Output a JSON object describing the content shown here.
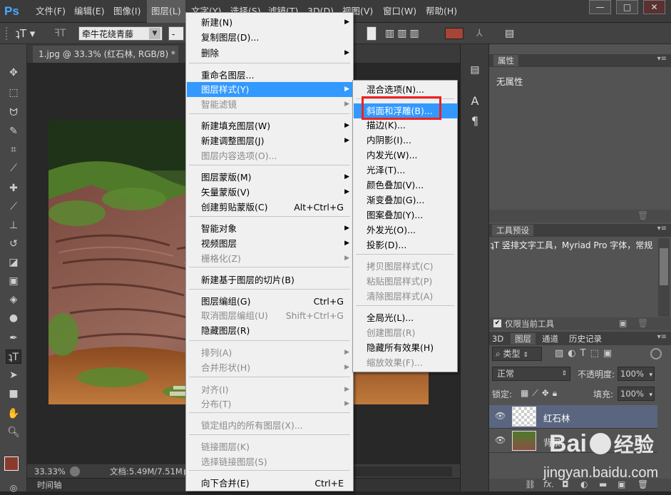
{
  "app": {
    "logo": "Ps"
  },
  "menubar": {
    "items": [
      "文件(F)",
      "编辑(E)",
      "图像(I)",
      "图层(L)",
      "文字(Y)",
      "选择(S)",
      "滤镜(T)",
      "3D(D)",
      "视图(V)",
      "窗口(W)",
      "帮助(H)"
    ],
    "window_controls": [
      "minimize",
      "maximize",
      "close"
    ]
  },
  "options_bar": {
    "tool_icon": "text-vertical-icon",
    "font_name": "牵牛花绕青藤",
    "font_style": "-",
    "color_swatch": "#a84436"
  },
  "document": {
    "tab_title": "1.jpg @ 33.3% (红石林, RGB/8) *",
    "close_label": "×"
  },
  "status": {
    "zoom": "33.33%",
    "doc_info": "文档:5.49M/7.51M"
  },
  "timeline": {
    "label": "时间轴"
  },
  "layer_menu": {
    "items": [
      {
        "label": "新建(N)",
        "shortcut": "",
        "arrow": true,
        "disabled": false
      },
      {
        "label": "复制图层(D)...",
        "shortcut": "",
        "arrow": false,
        "disabled": false
      },
      {
        "label": "删除",
        "shortcut": "",
        "arrow": true,
        "disabled": false
      },
      {
        "label": "重命名图层...",
        "shortcut": "",
        "arrow": false,
        "disabled": false
      },
      {
        "label": "图层样式(Y)",
        "shortcut": "",
        "arrow": true,
        "disabled": false
      },
      {
        "label": "智能滤镜",
        "shortcut": "",
        "arrow": true,
        "disabled": true
      },
      {
        "label": "新建填充图层(W)",
        "shortcut": "",
        "arrow": true,
        "disabled": false
      },
      {
        "label": "新建调整图层(J)",
        "shortcut": "",
        "arrow": true,
        "disabled": false
      },
      {
        "label": "图层内容选项(O)...",
        "shortcut": "",
        "arrow": false,
        "disabled": true
      },
      {
        "label": "图层蒙版(M)",
        "shortcut": "",
        "arrow": true,
        "disabled": false
      },
      {
        "label": "矢量蒙版(V)",
        "shortcut": "",
        "arrow": true,
        "disabled": false
      },
      {
        "label": "创建剪贴蒙版(C)",
        "shortcut": "Alt+Ctrl+G",
        "arrow": false,
        "disabled": false
      },
      {
        "label": "智能对象",
        "shortcut": "",
        "arrow": true,
        "disabled": false
      },
      {
        "label": "视频图层",
        "shortcut": "",
        "arrow": true,
        "disabled": false
      },
      {
        "label": "栅格化(Z)",
        "shortcut": "",
        "arrow": true,
        "disabled": true
      },
      {
        "label": "新建基于图层的切片(B)",
        "shortcut": "",
        "arrow": false,
        "disabled": false
      },
      {
        "label": "图层编组(G)",
        "shortcut": "Ctrl+G",
        "arrow": false,
        "disabled": false
      },
      {
        "label": "取消图层编组(U)",
        "shortcut": "Shift+Ctrl+G",
        "arrow": false,
        "disabled": true
      },
      {
        "label": "隐藏图层(R)",
        "shortcut": "",
        "arrow": false,
        "disabled": false
      },
      {
        "label": "排列(A)",
        "shortcut": "",
        "arrow": true,
        "disabled": true
      },
      {
        "label": "合并形状(H)",
        "shortcut": "",
        "arrow": true,
        "disabled": true
      },
      {
        "label": "对齐(I)",
        "shortcut": "",
        "arrow": true,
        "disabled": true
      },
      {
        "label": "分布(T)",
        "shortcut": "",
        "arrow": true,
        "disabled": true
      },
      {
        "label": "锁定组内的所有图层(X)...",
        "shortcut": "",
        "arrow": false,
        "disabled": true
      },
      {
        "label": "链接图层(K)",
        "shortcut": "",
        "arrow": false,
        "disabled": true
      },
      {
        "label": "选择链接图层(S)",
        "shortcut": "",
        "arrow": false,
        "disabled": true
      },
      {
        "label": "向下合并(E)",
        "shortcut": "Ctrl+E",
        "arrow": false,
        "disabled": false
      }
    ]
  },
  "style_submenu": {
    "items": [
      {
        "label": "混合选项(N)...",
        "disabled": false
      },
      {
        "label": "斜面和浮雕(B)...",
        "disabled": false
      },
      {
        "label": "描边(K)...",
        "disabled": false
      },
      {
        "label": "内阴影(I)...",
        "disabled": false
      },
      {
        "label": "内发光(W)...",
        "disabled": false
      },
      {
        "label": "光泽(T)...",
        "disabled": false
      },
      {
        "label": "颜色叠加(V)...",
        "disabled": false
      },
      {
        "label": "渐变叠加(G)...",
        "disabled": false
      },
      {
        "label": "图案叠加(Y)...",
        "disabled": false
      },
      {
        "label": "外发光(O)...",
        "disabled": false
      },
      {
        "label": "投影(D)...",
        "disabled": false
      },
      {
        "label": "拷贝图层样式(C)",
        "disabled": true
      },
      {
        "label": "粘贴图层样式(P)",
        "disabled": true
      },
      {
        "label": "清除图层样式(A)",
        "disabled": true
      },
      {
        "label": "全局光(L)...",
        "disabled": false
      },
      {
        "label": "创建图层(R)",
        "disabled": true
      },
      {
        "label": "隐藏所有效果(H)",
        "disabled": false
      },
      {
        "label": "缩放效果(F)...",
        "disabled": true
      }
    ]
  },
  "properties_panel": {
    "tab": "属性",
    "body": "无属性"
  },
  "tool_presets_panel": {
    "tab": "工具预设",
    "preset": "竖排文字工具，Myriad Pro 字体，常规",
    "checkbox_label": "仅限当前工具",
    "checked": true
  },
  "layers_panel": {
    "tabs": [
      "3D",
      "图层",
      "通道",
      "历史记录"
    ],
    "active_tab": "图层",
    "filter_label": "类型",
    "blend_mode": "正常",
    "opacity_label": "不透明度:",
    "opacity_value": "100%",
    "lock_label": "锁定:",
    "fill_label": "填充:",
    "fill_value": "100%",
    "layers": [
      {
        "name": "红石林",
        "selected": true
      },
      {
        "name": "背景",
        "selected": false
      }
    ],
    "footer_icons": [
      "link-icon",
      "fx-icon",
      "mask-icon",
      "adjustment-icon",
      "folder-icon",
      "new-layer-icon",
      "trash-icon"
    ],
    "fx_label": "fx."
  },
  "watermark": {
    "brand": "Bai",
    "brand2": "经验",
    "url": "jingyan.baidu.com"
  }
}
